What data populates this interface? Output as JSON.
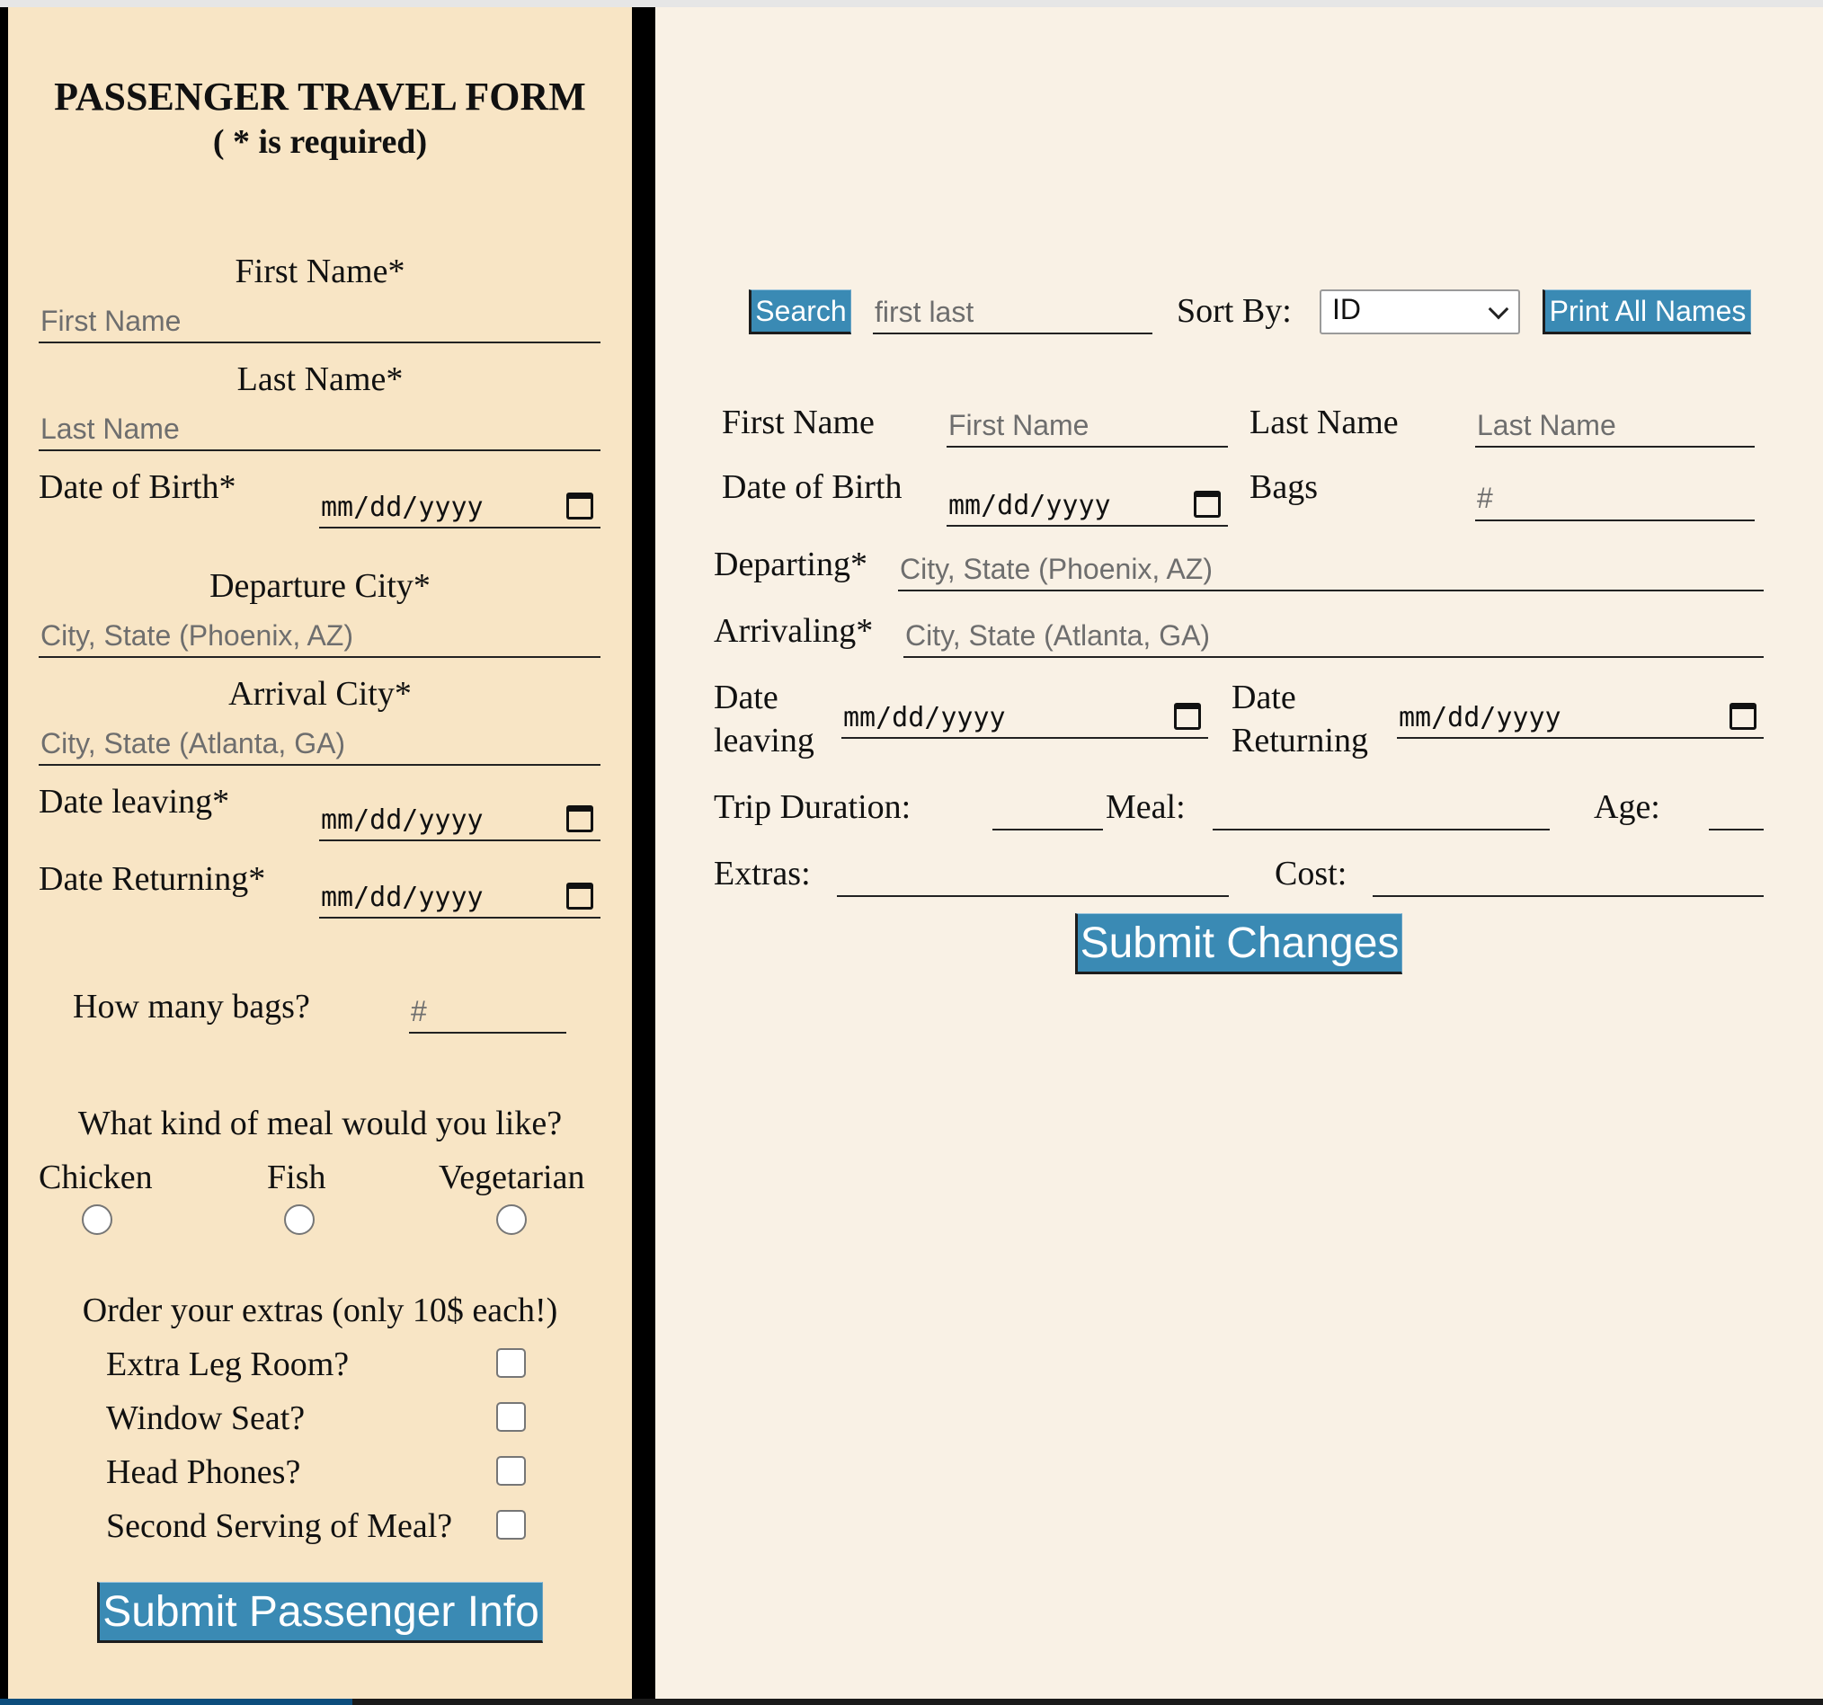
{
  "form": {
    "title": "PASSENGER TRAVEL FORM",
    "subtitle": "( * is required)",
    "first_name_label": "First Name*",
    "first_name_placeholder": "First Name",
    "last_name_label": "Last Name*",
    "last_name_placeholder": "Last Name",
    "dob_label": "Date of Birth*",
    "date_placeholder": "mm/dd/yyyy",
    "departure_label": "Departure City*",
    "departure_placeholder": "City, State (Phoenix, AZ)",
    "arrival_label": "Arrival City*",
    "arrival_placeholder": "City, State (Atlanta, GA)",
    "date_leaving_label": "Date leaving*",
    "date_returning_label": "Date Returning*",
    "bags_label": "How many bags?",
    "bags_placeholder": "#",
    "meal_question": "What kind of meal would you like?",
    "meal_options": [
      "Chicken",
      "Fish",
      "Vegetarian"
    ],
    "extras_question": "Order your extras (only 10$ each!)",
    "extras": [
      "Extra Leg Room?",
      "Window Seat?",
      "Head Phones?",
      "Second Serving of Meal?"
    ],
    "submit_label": "Submit Passenger Info"
  },
  "editor": {
    "search_button": "Search",
    "search_placeholder": "first last",
    "sort_label": "Sort By:",
    "sort_value": "ID",
    "print_button": "Print All Names",
    "first_name_label": "First Name",
    "first_name_placeholder": "First Name",
    "last_name_label": "Last Name",
    "last_name_placeholder": "Last Name",
    "dob_label": "Date of Birth",
    "date_placeholder": "mm/dd/yyyy",
    "bags_label": "Bags",
    "bags_placeholder": "#",
    "departing_label": "Departing*",
    "departing_placeholder": "City, State (Phoenix, AZ)",
    "arriving_label": "Arrivaling*",
    "arriving_placeholder": "City, State (Atlanta, GA)",
    "date_leaving_label_1": "Date",
    "date_leaving_label_2": "leaving",
    "date_returning_label_1": "Date",
    "date_returning_label_2": "Returning",
    "trip_duration_label": "Trip Duration:",
    "meal_label": "Meal:",
    "age_label": "Age:",
    "extras_label": "Extras:",
    "cost_label": "Cost:",
    "submit_label": "Submit Changes"
  }
}
